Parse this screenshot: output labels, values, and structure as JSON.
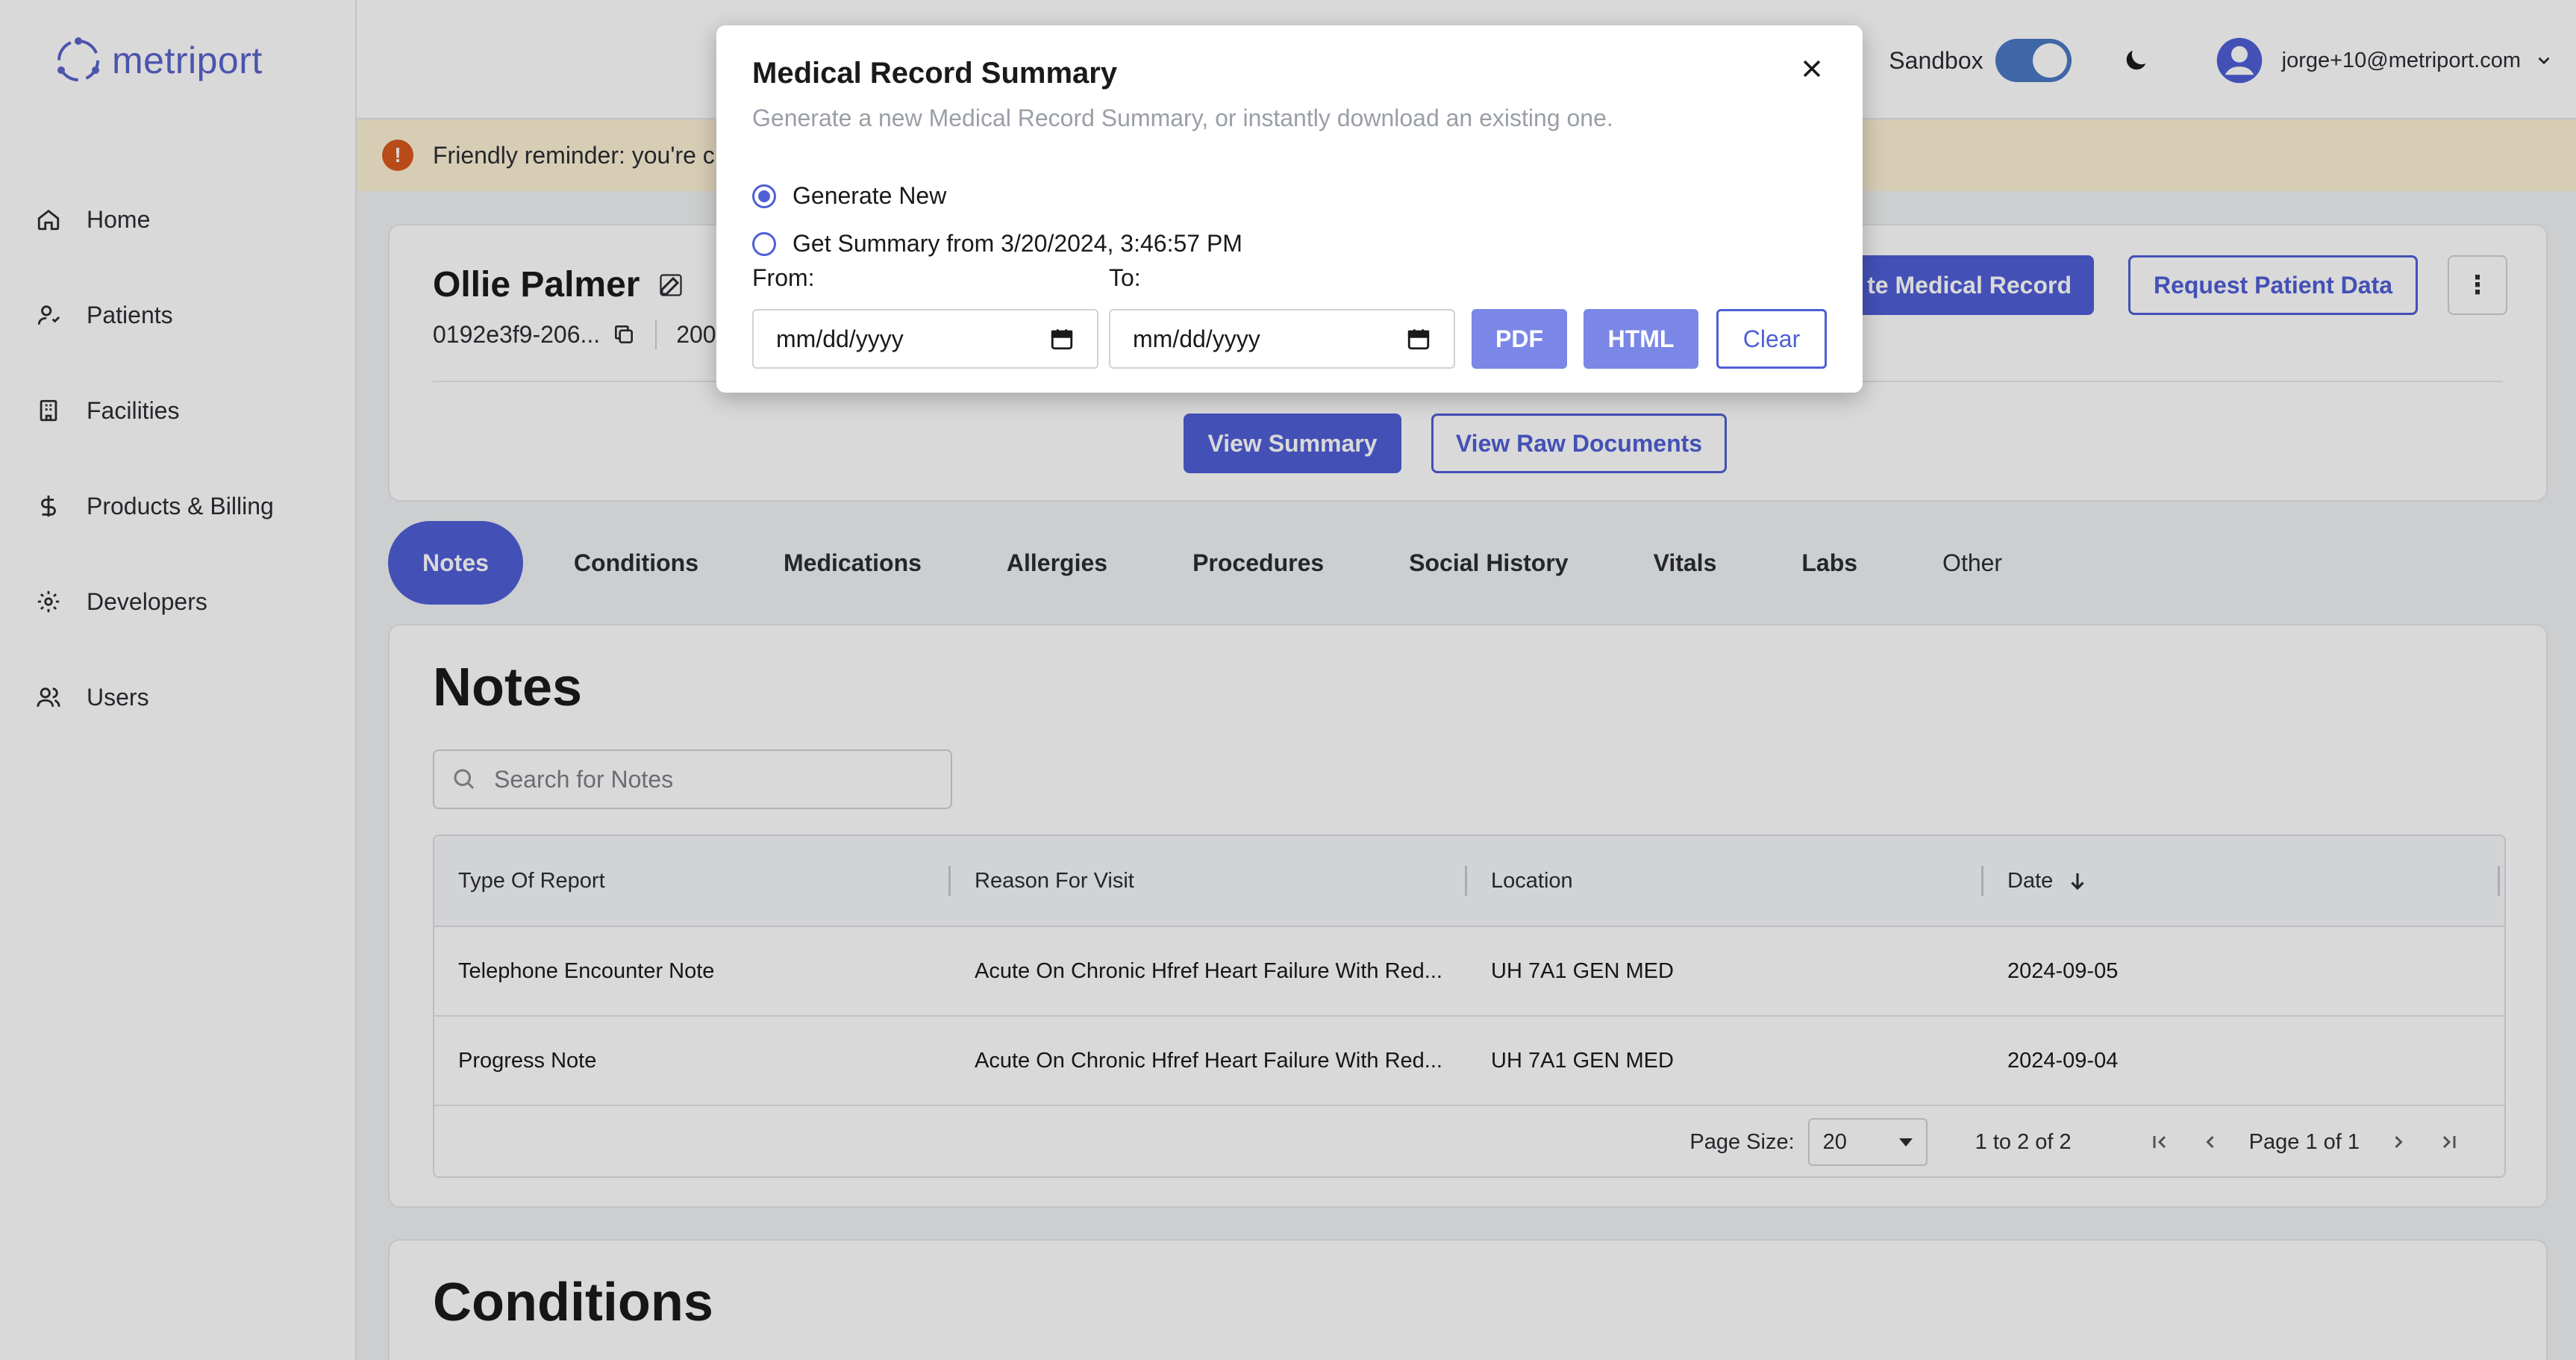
{
  "app": {
    "logo_text": "metriport",
    "accent": "#4f5fd6"
  },
  "sidebar": {
    "items": [
      {
        "label": "Home",
        "icon": "home-icon"
      },
      {
        "label": "Patients",
        "icon": "user-icon"
      },
      {
        "label": "Facilities",
        "icon": "building-icon"
      },
      {
        "label": "Products & Billing",
        "icon": "dollar-icon"
      },
      {
        "label": "Developers",
        "icon": "gear-icon"
      },
      {
        "label": "Users",
        "icon": "users-icon"
      }
    ]
  },
  "header": {
    "sandbox_label": "Sandbox",
    "sandbox_on": true,
    "user_email": "jorge+10@metriport.com"
  },
  "banner": {
    "text": "Friendly reminder: you're c"
  },
  "patient": {
    "name": "Ollie Palmer",
    "id_short": "0192e3f9-206...",
    "dob_partial": "200",
    "create_button": "te Medical Record",
    "request_button": "Request Patient Data",
    "more_button": "⋮",
    "view_summary": "View Summary",
    "view_raw": "View Raw Documents"
  },
  "tabs": [
    {
      "label": "Notes",
      "active": true
    },
    {
      "label": "Conditions"
    },
    {
      "label": "Medications"
    },
    {
      "label": "Allergies"
    },
    {
      "label": "Procedures"
    },
    {
      "label": "Social History"
    },
    {
      "label": "Vitals"
    },
    {
      "label": "Labs"
    },
    {
      "label": "Other"
    }
  ],
  "notes": {
    "title": "Notes",
    "search_placeholder": "Search for Notes",
    "columns": [
      "Type Of Report",
      "Reason For Visit",
      "Location",
      "Date"
    ],
    "rows": [
      [
        "Telephone Encounter Note",
        "Acute On Chronic Hfref Heart Failure With Red...",
        "UH 7A1 GEN MED",
        "2024-09-05"
      ],
      [
        "Progress Note",
        "Acute On Chronic Hfref Heart Failure With Red...",
        "UH 7A1 GEN MED",
        "2024-09-04"
      ]
    ],
    "page_size_label": "Page Size:",
    "page_size_value": "20",
    "range_text": "1 to 2 of 2",
    "page_text": "Page 1 of 1"
  },
  "conditions": {
    "title": "Conditions"
  },
  "modal": {
    "title": "Medical Record Summary",
    "subtitle": "Generate a new Medical Record Summary, or instantly download an existing one.",
    "option_new": "Generate New",
    "option_existing": "Get Summary from 3/20/2024, 3:46:57 PM",
    "selected_option": "Generate New",
    "from_label": "From:",
    "to_label": "To:",
    "from_value": "mm/dd/yyyy",
    "to_value": "mm/dd/yyyy",
    "pdf_button": "PDF",
    "html_button": "HTML",
    "clear_button": "Clear"
  }
}
